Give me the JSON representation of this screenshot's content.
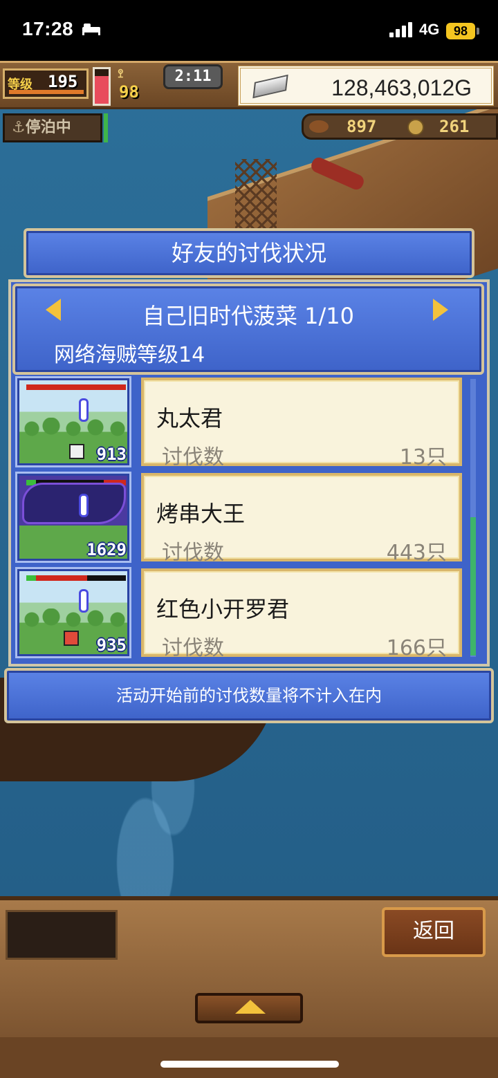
{
  "status_bar": {
    "time": "17:28",
    "network": "4G",
    "battery": "98"
  },
  "hud": {
    "level_label": "等级",
    "level_value": "195",
    "stamina_fraction": 0.8,
    "crew_icon": "ꖶ",
    "crew_value": "98",
    "timer": "2:11",
    "gold": "128,463,012G",
    "docked_status": "停泊中",
    "resource_1": "897",
    "resource_2": "261"
  },
  "dialog": {
    "title": "好友的讨伐状况",
    "friend_name": "自己旧时代菠菜 1/10",
    "pirate_level": "网络海贼等级14",
    "rows": [
      {
        "name": "丸太君",
        "label": "讨伐数",
        "count": "13只",
        "score": "913"
      },
      {
        "name": "烤串大王",
        "label": "讨伐数",
        "count": "443只",
        "score": "1629"
      },
      {
        "name": "红色小开罗君",
        "label": "讨伐数",
        "count": "166只",
        "score": "935"
      }
    ],
    "footer_note": "活动开始前的讨伐数量将不计入在内"
  },
  "bottom": {
    "back_label": "返回"
  },
  "icons": {
    "prev": "left-arrow-icon",
    "next": "right-arrow-icon",
    "up": "up-arrow-icon"
  },
  "colors": {
    "panel_blue": "#4a70d8",
    "accent_yellow": "#f3c23c",
    "card_cream": "#f9f3dc"
  }
}
